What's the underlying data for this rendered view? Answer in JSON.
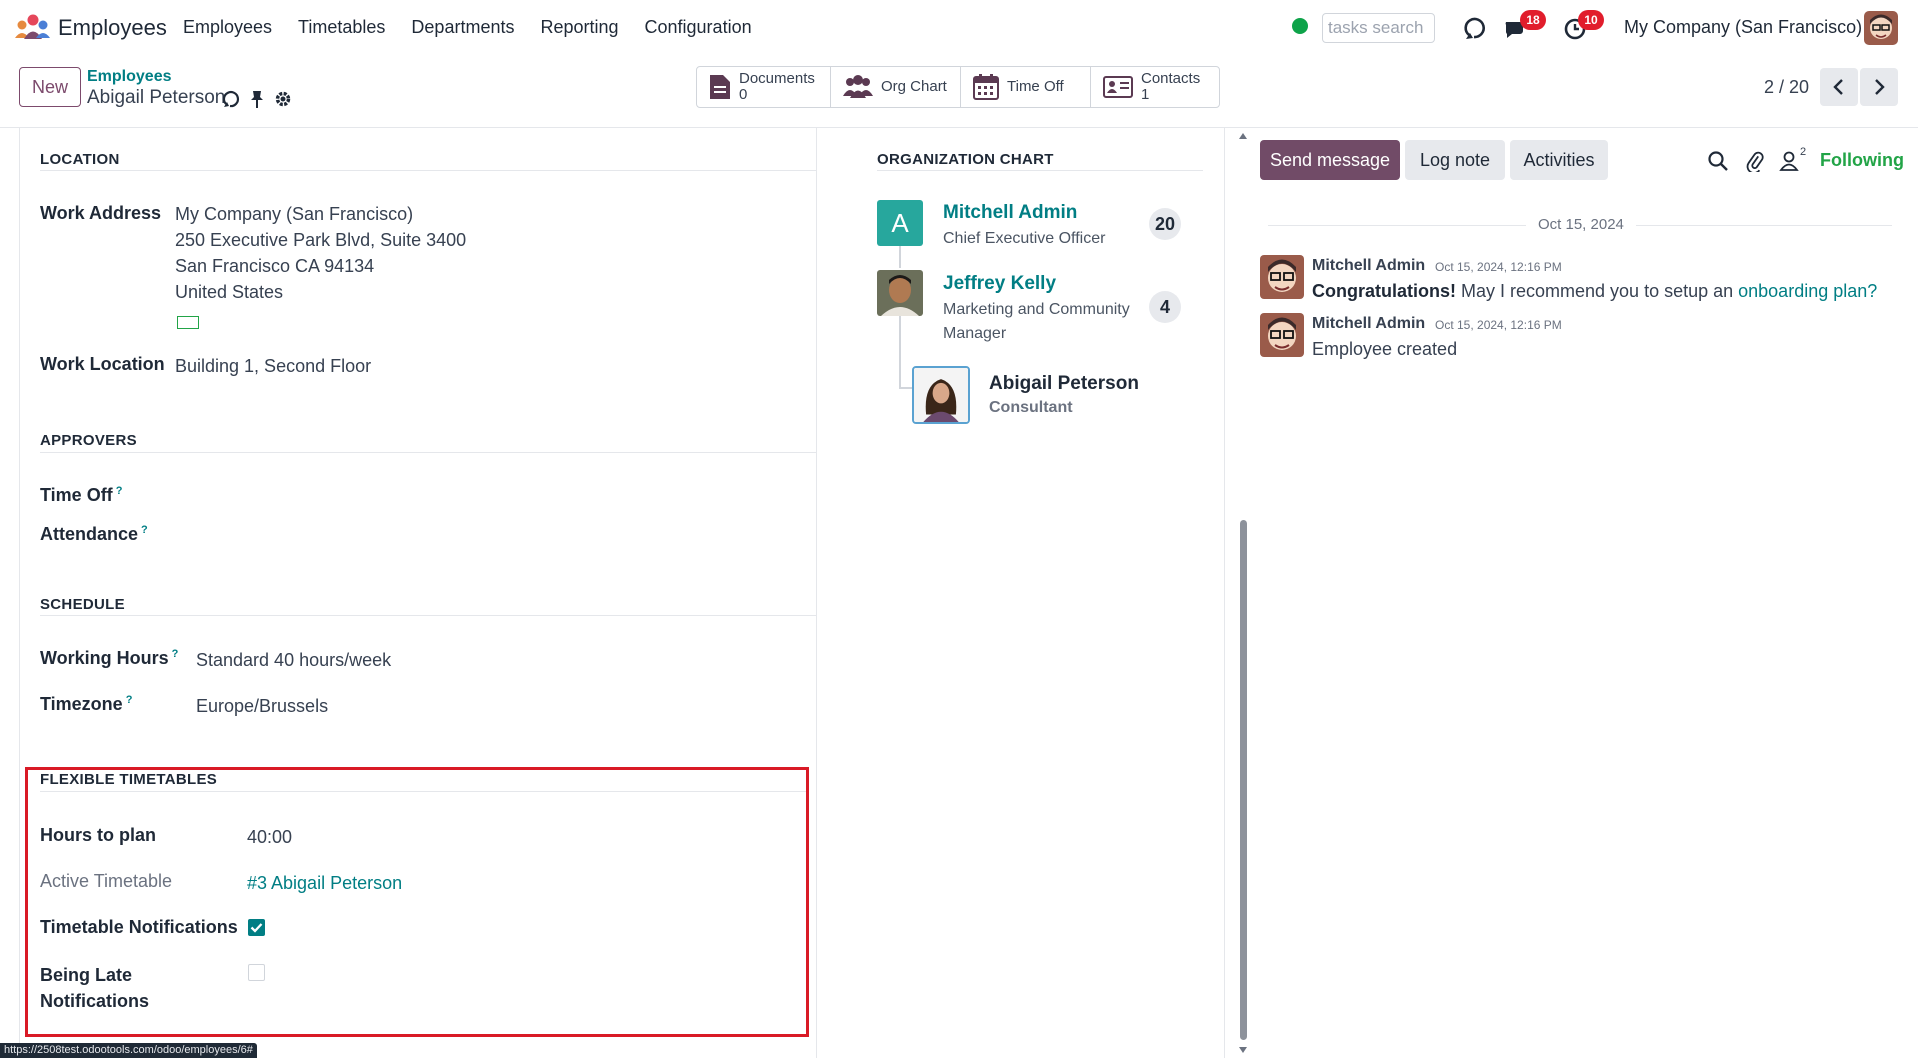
{
  "topbar": {
    "app_name": "Employees",
    "menu": [
      "Employees",
      "Timetables",
      "Departments",
      "Reporting",
      "Configuration"
    ],
    "search_placeholder": "tasks search",
    "messages_badge": "18",
    "activities_badge": "10",
    "company": "My Company (San Francisco)"
  },
  "control": {
    "new_label": "New",
    "breadcrumb_parent": "Employees",
    "breadcrumb_current": "Abigail Peterson",
    "smart_buttons": [
      {
        "label": "Documents",
        "count": "0"
      },
      {
        "label": "Org Chart",
        "count": ""
      },
      {
        "label": "Time Off",
        "count": ""
      },
      {
        "label": "Contacts",
        "count": "1"
      }
    ],
    "pager": "2 / 20"
  },
  "location": {
    "title": "LOCATION",
    "work_address_label": "Work Address",
    "work_address": [
      "My Company (San Francisco)",
      "250 Executive Park Blvd, Suite 3400",
      "San Francisco CA 94134",
      "United States"
    ],
    "work_location_label": "Work Location",
    "work_location": "Building 1, Second Floor"
  },
  "approvers": {
    "title": "APPROVERS",
    "time_off_label": "Time Off",
    "attendance_label": "Attendance"
  },
  "schedule": {
    "title": "SCHEDULE",
    "working_hours_label": "Working Hours",
    "working_hours": "Standard 40 hours/week",
    "timezone_label": "Timezone",
    "timezone": "Europe/Brussels"
  },
  "flexible": {
    "title": "FLEXIBLE TIMETABLES",
    "hours_label": "Hours to plan",
    "hours": "40:00",
    "active_label": "Active Timetable",
    "active": "#3 Abigail Peterson",
    "notif_label": "Timetable Notifications",
    "notif_checked": true,
    "late_label_1": "Being Late",
    "late_label_2": "Notifications",
    "late_checked": false
  },
  "org_chart": {
    "title": "ORGANIZATION CHART",
    "manager": {
      "initial": "A",
      "name": "Mitchell Admin",
      "job": "Chief Executive Officer",
      "count": "20"
    },
    "middle": {
      "name": "Jeffrey Kelly",
      "job_1": "Marketing and Community",
      "job_2": "Manager",
      "count": "4"
    },
    "self": {
      "name": "Abigail Peterson",
      "job": "Consultant"
    }
  },
  "chatter": {
    "send_label": "Send message",
    "log_label": "Log note",
    "activities_label": "Activities",
    "followers_count": "2",
    "following_label": "Following",
    "date": "Oct 15, 2024",
    "messages": [
      {
        "author": "Mitchell Admin",
        "time": "Oct 15, 2024, 12:16 PM",
        "bold": "Congratulations!",
        "text": " May I recommend you to setup an ",
        "link": "onboarding plan?"
      },
      {
        "author": "Mitchell Admin",
        "time": "Oct 15, 2024, 12:16 PM",
        "text": "Employee created"
      }
    ]
  },
  "status_url": "https://2508test.odootools.com/odoo/employees/6#",
  "colors": {
    "brand": "#714b67",
    "link": "#017e84",
    "highlight": "#d91a26",
    "online": "#0ea34a"
  }
}
